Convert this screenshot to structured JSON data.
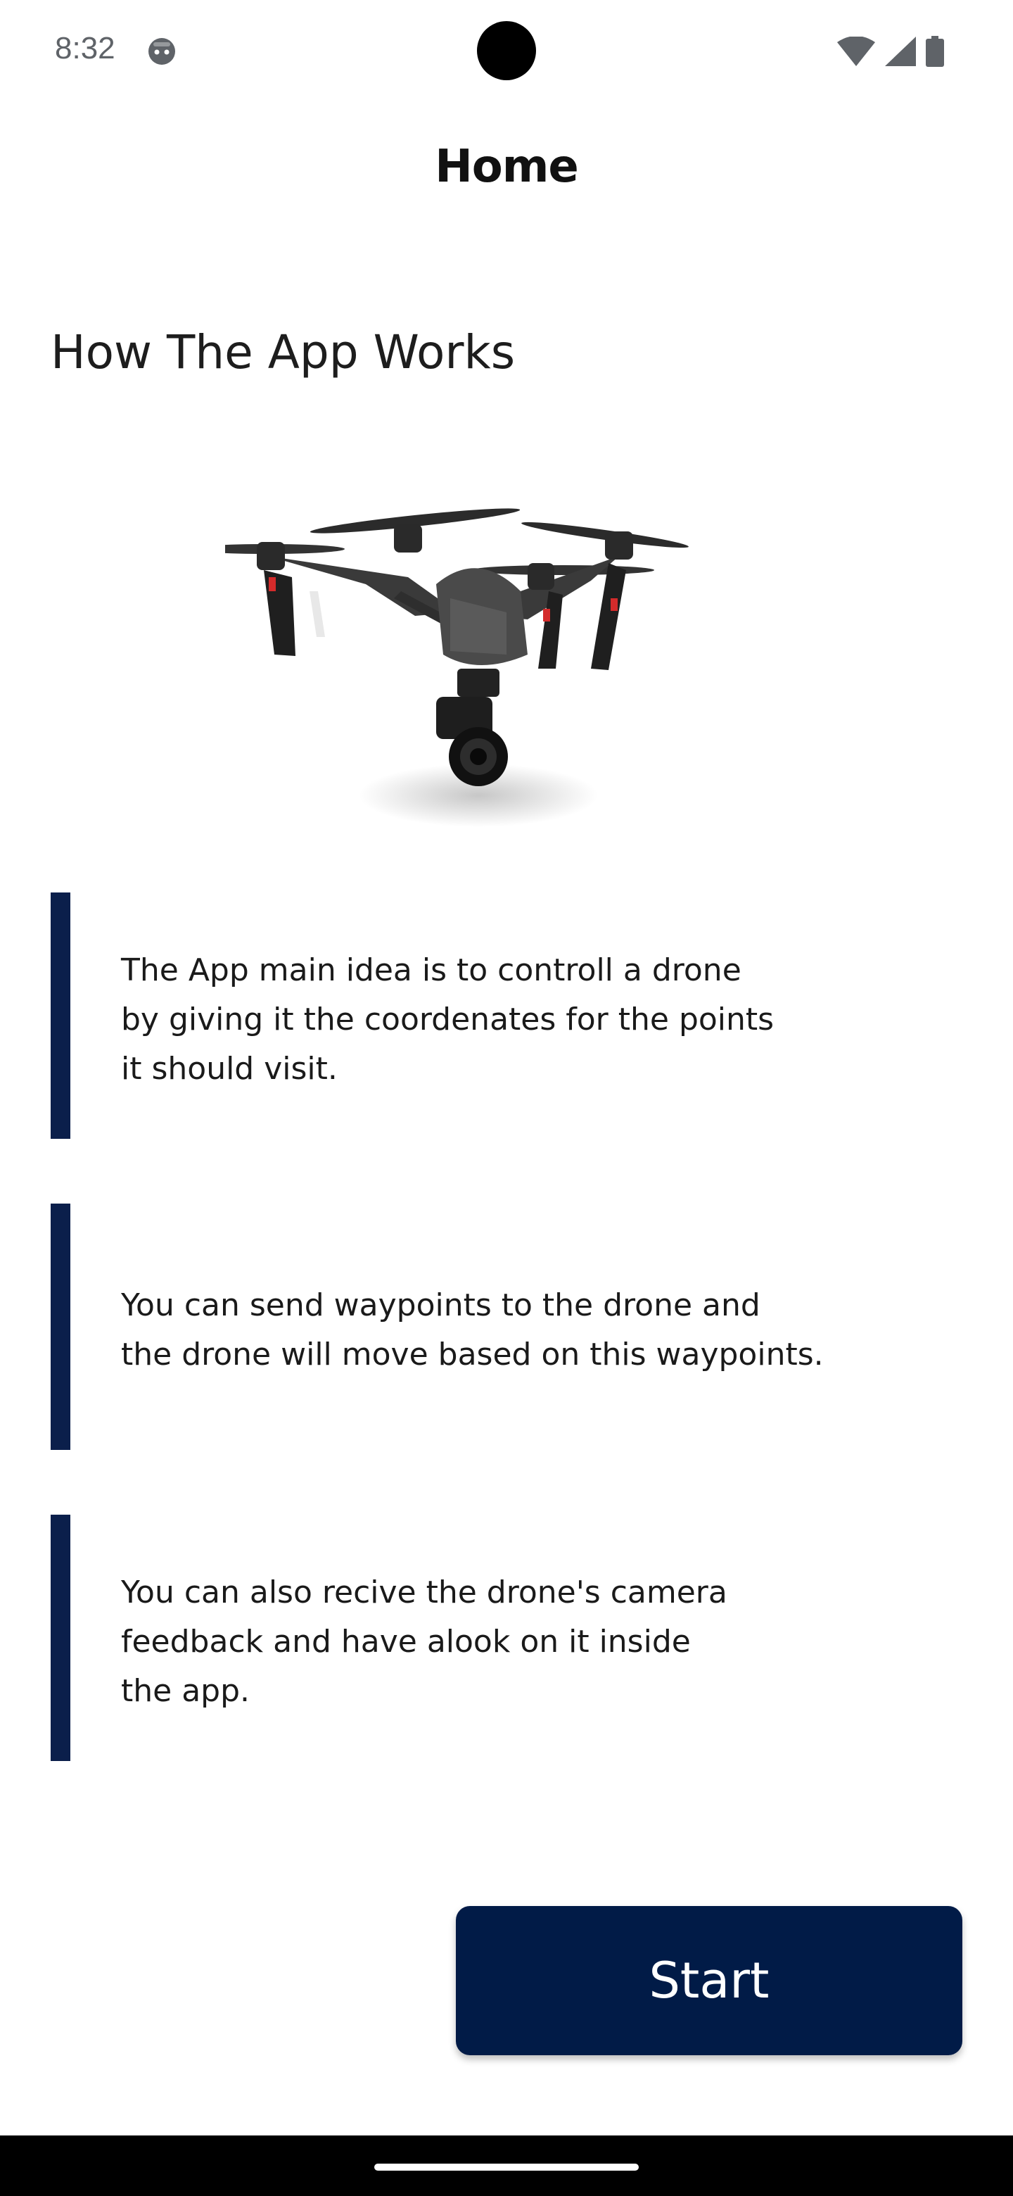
{
  "status_bar": {
    "time": "8:32",
    "icons": [
      "android-face-icon",
      "wifi-icon",
      "signal-icon",
      "battery-icon"
    ]
  },
  "app_bar": {
    "title": "Home"
  },
  "section": {
    "heading": "How The App Works",
    "image_icon": "drone-icon"
  },
  "info_blocks": [
    {
      "text": "The App main idea is to controll a drone\nby giving it the coordenates for the points\nit should visit."
    },
    {
      "text": "You can send waypoints to the drone and\nthe drone will move based on this waypoints."
    },
    {
      "text": "You can also recive the drone's camera\nfeedback and have alook on it inside\nthe app."
    }
  ],
  "actions": {
    "start_label": "Start"
  },
  "colors": {
    "accent_bar": "#0b1f4b",
    "button_bg": "#011b47",
    "button_text": "#ffffff",
    "nav_bar": "#000000"
  }
}
